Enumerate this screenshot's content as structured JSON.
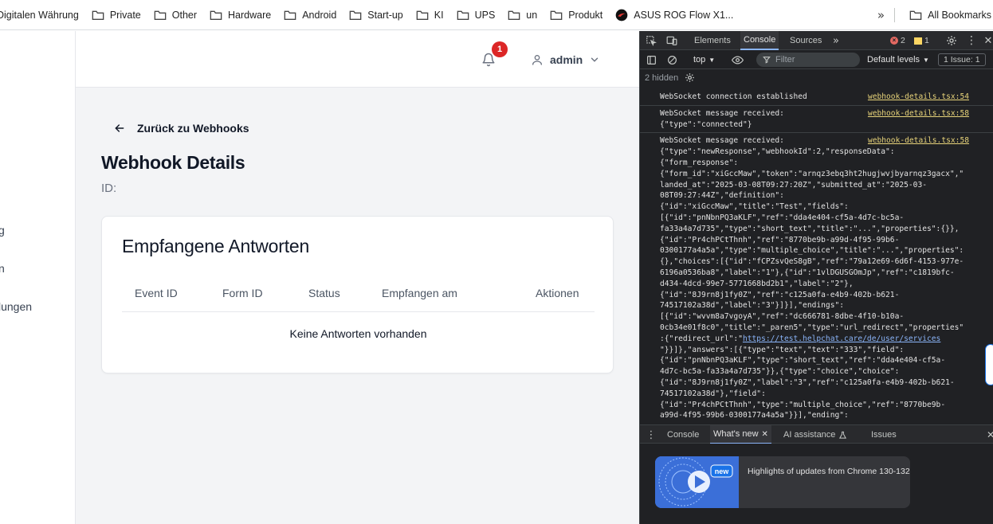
{
  "bookmarks": {
    "items": [
      {
        "label": "Digitalen Währung",
        "icon": "folder-icon"
      },
      {
        "label": "Private",
        "icon": "folder-icon"
      },
      {
        "label": "Other",
        "icon": "folder-icon"
      },
      {
        "label": "Hardware",
        "icon": "folder-icon"
      },
      {
        "label": "Android",
        "icon": "folder-icon"
      },
      {
        "label": "Start-up",
        "icon": "folder-icon"
      },
      {
        "label": "KI",
        "icon": "folder-icon"
      },
      {
        "label": "UPS",
        "icon": "folder-icon"
      },
      {
        "label": "un",
        "icon": "folder-icon"
      },
      {
        "label": "Produkt",
        "icon": "folder-icon"
      },
      {
        "label": "ASUS ROG Flow X1...",
        "icon": "rog-logo-icon"
      }
    ],
    "overflow": "»",
    "all_bookmarks": "All Bookmarks"
  },
  "sidebar": {
    "items": [
      {
        "label": "g"
      },
      {
        "label": "n"
      },
      {
        "label": "lungen"
      }
    ]
  },
  "header": {
    "notification_count": "1",
    "user_name": "admin"
  },
  "main": {
    "back_label": "Zurück zu Webhooks",
    "title": "Webhook Details",
    "id_label": "ID:"
  },
  "responses": {
    "title": "Empfangene Antworten",
    "columns": [
      "Event ID",
      "Form ID",
      "Status",
      "Empfangen am",
      "Aktionen"
    ],
    "empty_text": "Keine Antworten vorhanden"
  },
  "devtools": {
    "tabs": [
      "Elements",
      "Console",
      "Sources"
    ],
    "active_tab": "Console",
    "more_tabs": "»",
    "error_count": "2",
    "warning_count": "1",
    "context": "top",
    "filter_placeholder": "Filter",
    "levels": "Default levels",
    "issues": "1 Issue: 1",
    "hidden_text": "2 hidden",
    "console_messages": [
      {
        "source": "webhook-details.tsx:54",
        "lines": [
          "WebSocket connection established"
        ]
      },
      {
        "source": "webhook-details.tsx:58",
        "lines": [
          "WebSocket message received:",
          "{\"type\":\"connected\"}"
        ]
      },
      {
        "source": "webhook-details.tsx:58",
        "lines": [
          "WebSocket message received:",
          "{\"type\":\"newResponse\",\"webhookId\":2,\"responseData\":",
          "{\"form_response\":",
          "{\"form_id\":\"xiGccMaw\",\"token\":\"arnqz3ebq3ht2hugjwvjbyarnqz3gacx\",\"",
          "landed_at\":\"2025-03-08T09:27:20Z\",\"submitted_at\":\"2025-03-",
          "08T09:27:44Z\",\"definition\":",
          "{\"id\":\"xiGccMaw\",\"title\":\"Test\",\"fields\":",
          "[{\"id\":\"pnNbnPQ3aKLF\",\"ref\":\"dda4e404-cf5a-4d7c-bc5a-",
          "fa33a4a7d735\",\"type\":\"short_text\",\"title\":\"...\",\"properties\":{}},",
          "{\"id\":\"Pr4chPCtThnh\",\"ref\":\"8770be9b-a99d-4f95-99b6-",
          "0300177a4a5a\",\"type\":\"multiple_choice\",\"title\":\"...\",\"properties\":",
          "{},\"choices\":[{\"id\":\"fCPZsvQeS8gB\",\"ref\":\"79a12e69-6d6f-4153-977e-",
          "6196a0536ba8\",\"label\":\"1\"},{\"id\":\"1vlDGUSGOmJp\",\"ref\":\"c1819bfc-",
          "d434-4dcd-99e7-5771668bd2b1\",\"label\":\"2\"},",
          "{\"id\":\"8J9rn8j1fy0Z\",\"ref\":\"c125a0fa-e4b9-402b-b621-",
          "74517102a38d\",\"label\":\"3\"}]}],\"endings\":",
          "[{\"id\":\"wvvm8a7vgoyA\",\"ref\":\"dc666781-8dbe-4f10-b10a-",
          "0cb34e01f8c0\",\"title\":\"_paren5\",\"type\":\"url_redirect\",\"properties\"",
          ":{\"redirect_url\":\"https://test.helpchat.care/de/user/services",
          "\"}}]},\"answers\":[{\"type\":\"text\",\"text\":\"333\",\"field\":",
          "{\"id\":\"pnNbnPQ3aKLF\",\"type\":\"short_text\",\"ref\":\"dda4e404-cf5a-",
          "4d7c-bc5a-fa33a4a7d735\"}},{\"type\":\"choice\",\"choice\":",
          "{\"id\":\"8J9rn8j1fy0Z\",\"label\":\"3\",\"ref\":\"c125a0fa-e4b9-402b-b621-",
          "74517102a38d\"},\"field\":",
          "{\"id\":\"Pr4chPCtThnh\",\"type\":\"multiple_choice\",\"ref\":\"8770be9b-",
          "a99d-4f95-99b6-0300177a4a5a\"}}],\"ending\":"
        ]
      }
    ],
    "drawer_tabs": [
      "Console",
      "What's new",
      "AI assistance",
      "Issues"
    ],
    "drawer_active": "What's new",
    "promo_badge": "new",
    "promo_text": "Highlights of updates from Chrome 130-132"
  },
  "colors": {
    "badge": "#dc2626",
    "devtools_bg": "#202124",
    "link": "#e8d47a"
  }
}
